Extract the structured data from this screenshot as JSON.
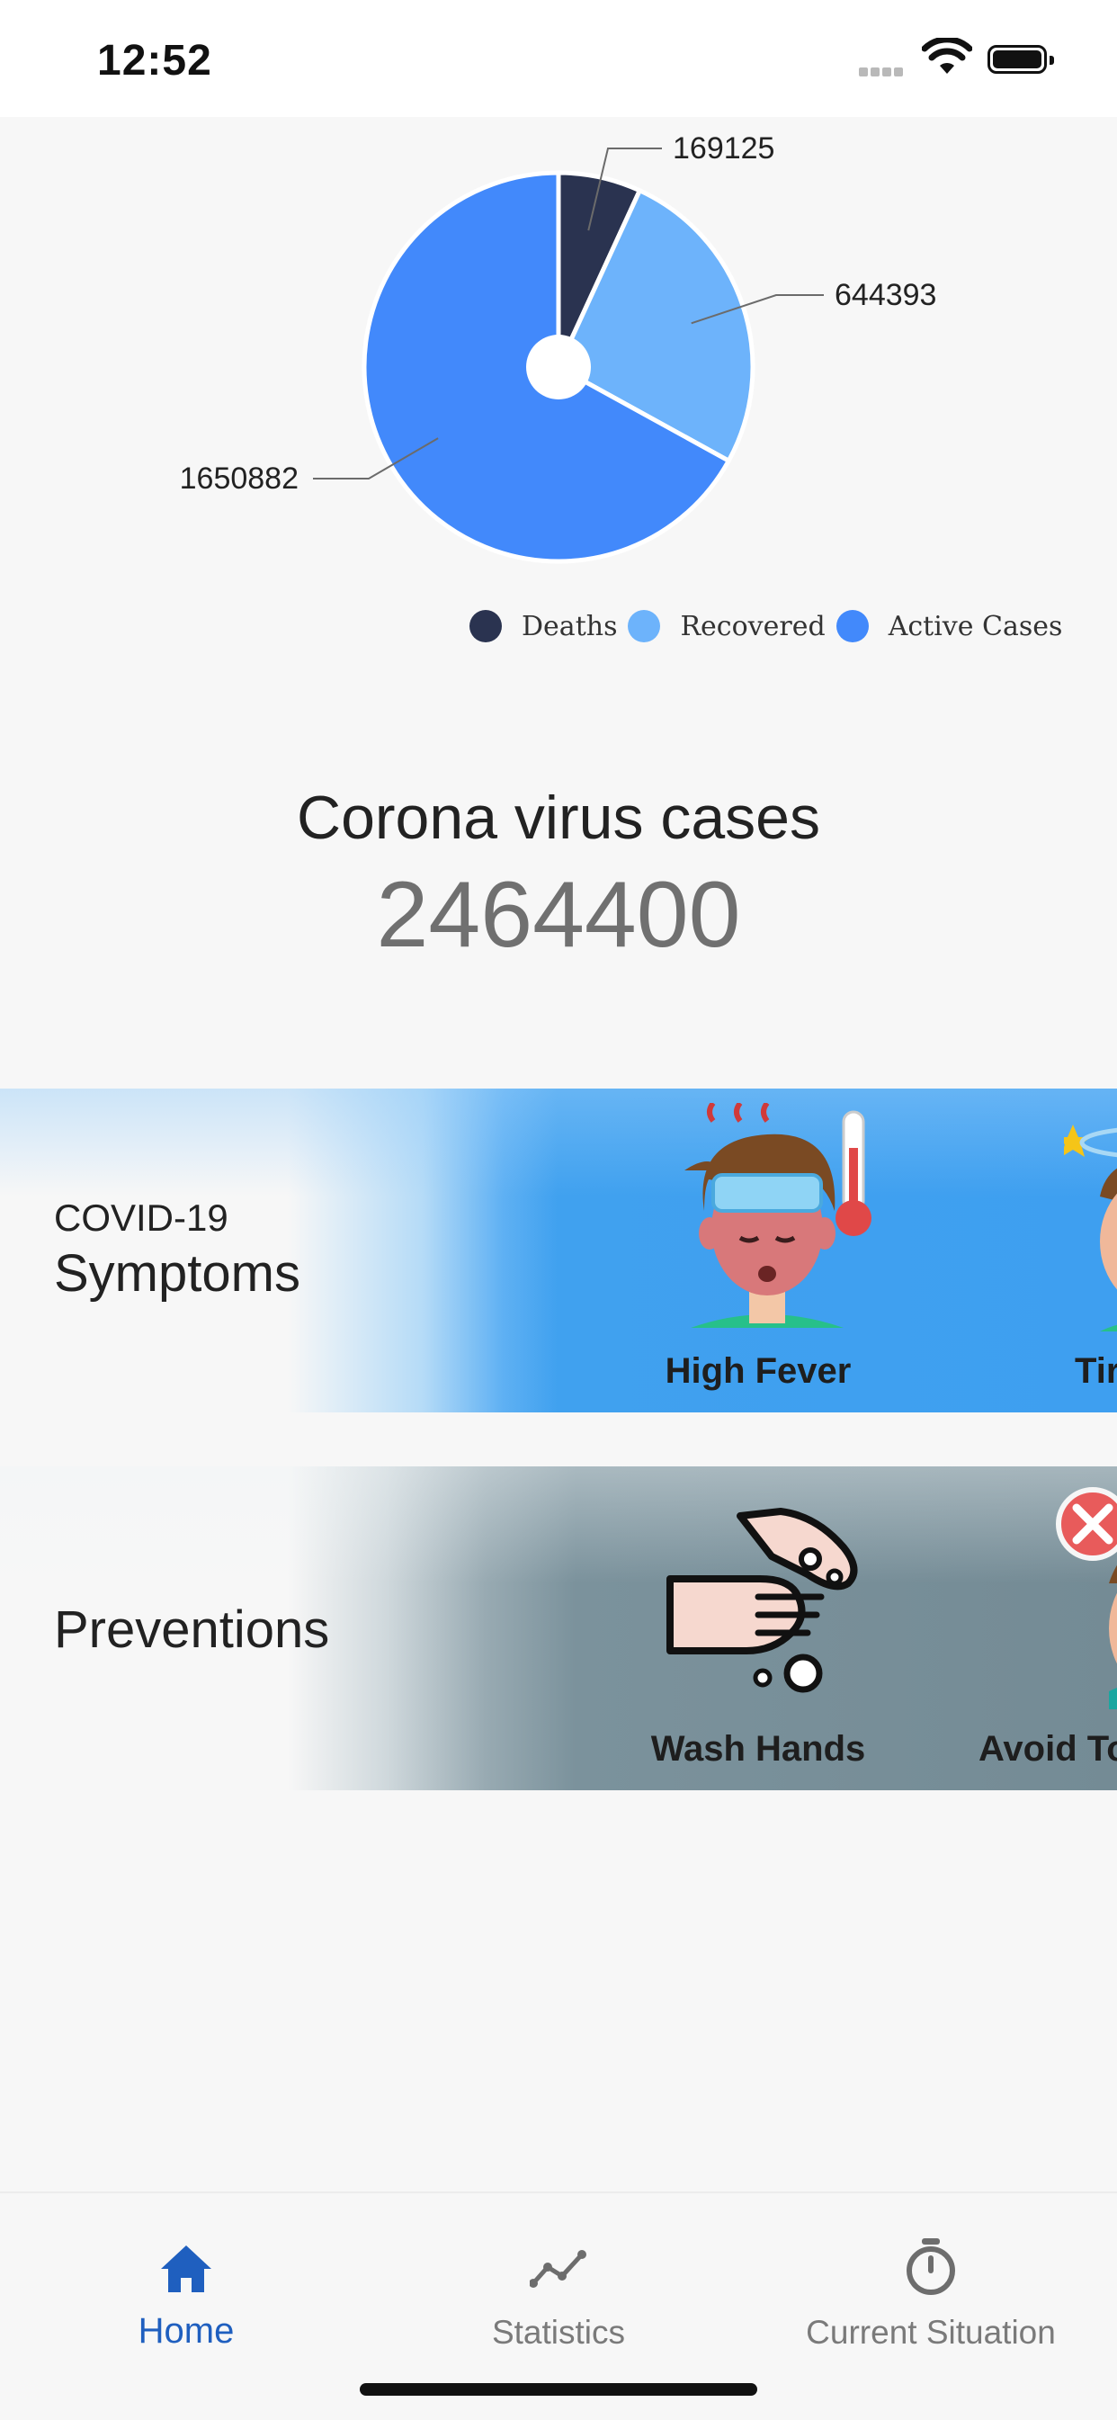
{
  "status_bar": {
    "time": "12:52"
  },
  "chart_data": {
    "type": "pie",
    "donut": true,
    "slices": [
      {
        "label": "Deaths",
        "value": 169125,
        "color": "#2a3350"
      },
      {
        "label": "Recovered",
        "value": 644393,
        "color": "#6db3fb"
      },
      {
        "label": "Active Cases",
        "value": 1650882,
        "color": "#4289fb"
      }
    ],
    "data_labels": [
      "169125",
      "644393",
      "1650882"
    ],
    "legend": [
      "Deaths",
      "Recovered",
      "Active Cases"
    ],
    "legend_position": "bottom-right"
  },
  "total": {
    "title": "Corona virus cases",
    "value": "2464400"
  },
  "symptoms": {
    "subtitle": "COVID-19",
    "title": "Symptoms",
    "tiles": [
      {
        "label": "High Fever",
        "icon": "fever-person-icon"
      },
      {
        "label": "Tir",
        "icon": "tired-person-icon"
      }
    ]
  },
  "preventions": {
    "title": "Preventions",
    "tiles": [
      {
        "label": "Wash Hands",
        "icon": "wash-hands-icon"
      },
      {
        "label": "Avoid To",
        "icon": "avoid-touch-icon"
      }
    ]
  },
  "nav": {
    "items": [
      {
        "label": "Home",
        "icon": "home-icon",
        "active": true
      },
      {
        "label": "Statistics",
        "icon": "statistics-icon",
        "active": false
      },
      {
        "label": "Current Situation",
        "icon": "stopwatch-icon",
        "active": false
      }
    ],
    "active_color": "#1f5fbf",
    "inactive_color": "#7a7a7a"
  }
}
